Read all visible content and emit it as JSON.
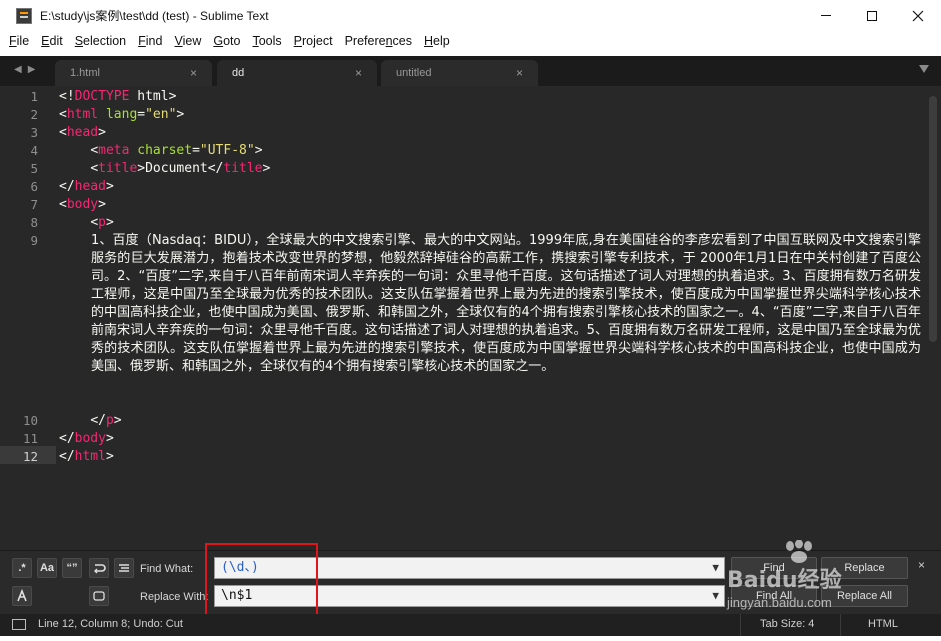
{
  "window": {
    "title": "E:\\study\\js案例\\test\\dd (test) - Sublime Text",
    "controls": [
      "minimize",
      "maximize",
      "close"
    ]
  },
  "menu": [
    {
      "label": "File",
      "key": "F",
      "rest": "ile"
    },
    {
      "label": "Edit",
      "key": "E",
      "rest": "dit"
    },
    {
      "label": "Selection",
      "key": "S",
      "rest": "election"
    },
    {
      "label": "Find",
      "key": "F",
      "rest": "ind",
      "pre": ""
    },
    {
      "label": "View",
      "key": "V",
      "rest": "iew"
    },
    {
      "label": "Goto",
      "key": "G",
      "rest": "oto"
    },
    {
      "label": "Tools",
      "key": "T",
      "rest": "ools"
    },
    {
      "label": "Project",
      "key": "P",
      "rest": "roject"
    },
    {
      "label": "Preferences",
      "key": "n",
      "pre": "Prefere",
      "rest": "ces"
    },
    {
      "label": "Help",
      "key": "H",
      "rest": "elp"
    }
  ],
  "tabs": [
    {
      "label": "1.html",
      "active": false
    },
    {
      "label": "dd",
      "active": true
    },
    {
      "label": "untitled",
      "active": false
    }
  ],
  "editor": {
    "line_numbers": [
      "1",
      "2",
      "3",
      "4",
      "5",
      "6",
      "7",
      "8",
      "9",
      "10",
      "11",
      "12"
    ],
    "current_line": "12",
    "lines": {
      "l1": {
        "a": "<!",
        "b": "DOCTYPE",
        "c": " html>"
      },
      "l2": {
        "a": "<",
        "b": "html",
        "c": " ",
        "d": "lang",
        "e": "=",
        "f": "\"en\"",
        "g": ">"
      },
      "l3": {
        "a": "<",
        "b": "head",
        "c": ">"
      },
      "l4": {
        "indent": "    ",
        "a": "<",
        "b": "meta",
        "c": " ",
        "d": "charset",
        "e": "=",
        "f": "\"UTF-8\"",
        "g": ">"
      },
      "l5": {
        "indent": "    ",
        "a": "<",
        "b": "title",
        "c": ">Document</",
        "d": "title",
        "e": ">"
      },
      "l6": {
        "a": "</",
        "b": "head",
        "c": ">"
      },
      "l7": {
        "a": "<",
        "b": "body",
        "c": ">"
      },
      "l8": {
        "indent": "    ",
        "a": "<",
        "b": "p",
        "c": ">"
      },
      "l9": "1、百度（Nasdaq：BIDU），全球最大的中文搜索引擎、最大的中文网站。1999年底,身在美国硅谷的李彦宏看到了中国互联网及中文搜索引擎服务的巨大发展潜力，抱着技术改变世界的梦想，他毅然辞掉硅谷的高薪工作，携搜索引擎专利技术，于 2000年1月1日在中关村创建了百度公司。2、“百度”二字,来自于八百年前南宋词人辛弃疾的一句词：众里寻他千百度。这句话描述了词人对理想的执着追求。3、百度拥有数万名研发工程师，这是中国乃至全球最为优秀的技术团队。这支队伍掌握着世界上最为先进的搜索引擎技术，使百度成为中国掌握世界尖端科学核心技术的中国高科技企业，也使中国成为美国、俄罗斯、和韩国之外，全球仅有的4个拥有搜索引擎核心技术的国家之一。4、“百度”二字,来自于八百年前南宋词人辛弃疾的一句词：众里寻他千百度。这句话描述了词人对理想的执着追求。5、百度拥有数万名研发工程师，这是中国乃至全球最为优秀的技术团队。这支队伍掌握着世界上最为先进的搜索引擎技术，使百度成为中国掌握世界尖端科学核心技术的中国高科技企业，也使中国成为美国、俄罗斯、和韩国之外，全球仅有的4个拥有搜索引擎核心技术的国家之一。",
      "l10": {
        "indent": "    ",
        "a": "</",
        "b": "p",
        "c": ">"
      },
      "l11": {
        "a": "</",
        "b": "body",
        "c": ">"
      },
      "l12": {
        "a": "</",
        "b": "html",
        "c": ">"
      }
    }
  },
  "find_panel": {
    "toggles": [
      ".*",
      "Aa",
      "“”",
      "wrap",
      "in-selection",
      "highlight-matches",
      "preserve-case"
    ],
    "find_label": "Find What:",
    "find_value": "(\\d、)",
    "replace_label": "Replace With:",
    "replace_value": "\\n$1",
    "buttons": {
      "find": "Find",
      "replace": "Replace",
      "find_all": "Find All",
      "replace_all": "Replace All"
    },
    "close": "×"
  },
  "status": {
    "position": "Line 12, Column 8; Undo: Cut",
    "tab_size": "Tab Size: 4",
    "syntax": "HTML"
  },
  "watermark": {
    "brand": "Baidu经验",
    "url": "jingyan.baidu.com"
  },
  "colors": {
    "tag": "#f92672",
    "attribute": "#a6e22e",
    "string": "#e6db74",
    "highlight": "#e0141b"
  }
}
